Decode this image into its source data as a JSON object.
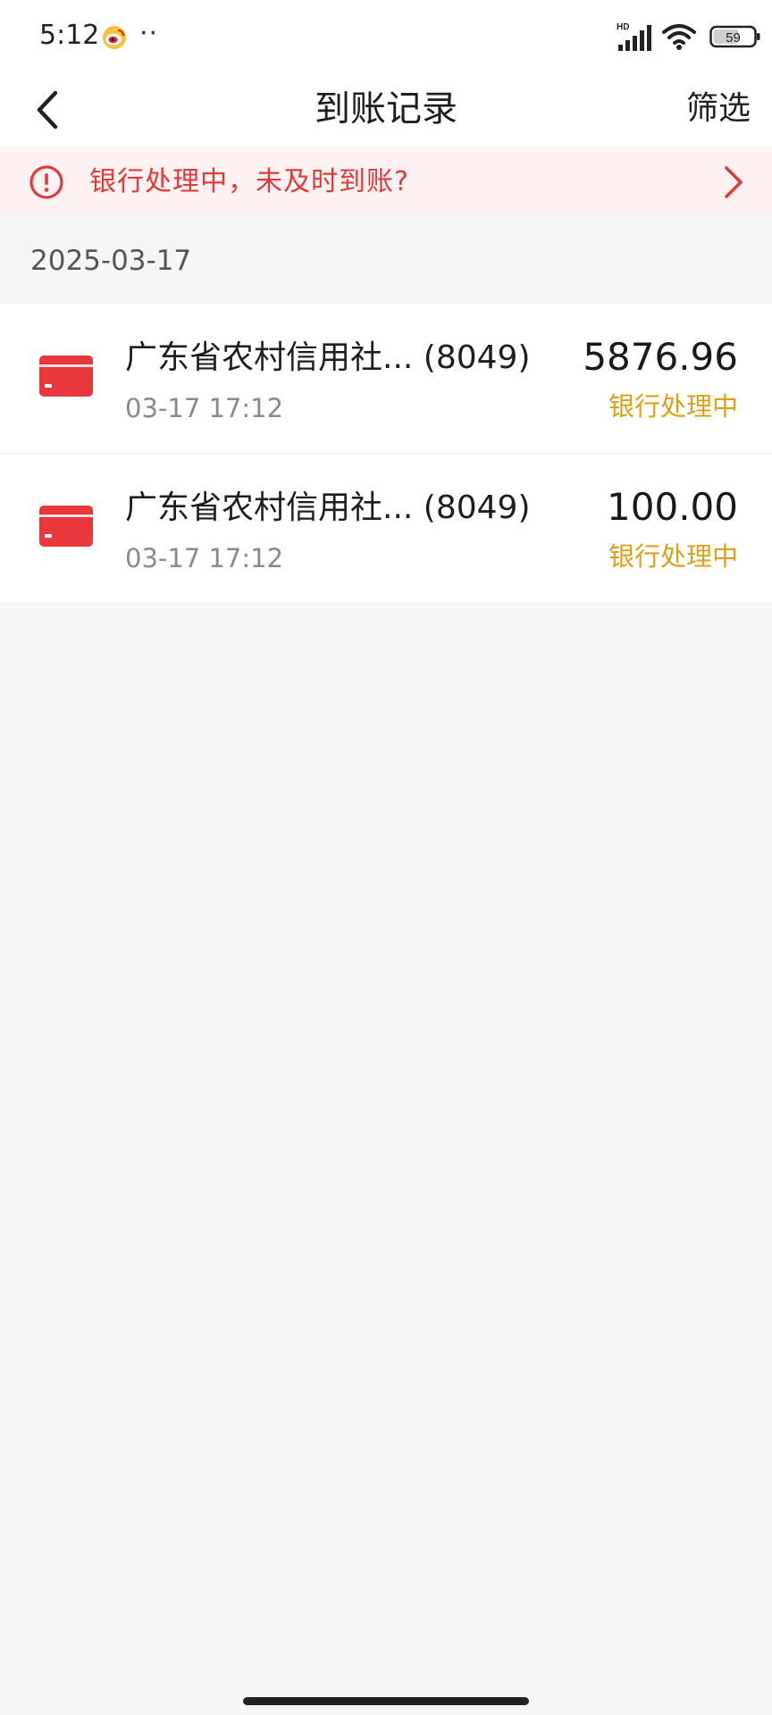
{
  "status_bar": {
    "time": "5:12",
    "notification_icon": "weibo-icon",
    "dots": "··",
    "network_label": "HD",
    "battery": "59"
  },
  "nav": {
    "title": "到账记录",
    "filter_label": "筛选",
    "back_icon": "chevron-left-icon"
  },
  "alert": {
    "text": "银行处理中，未及时到账?",
    "icon": "exclamation-circle-icon",
    "arrow_icon": "chevron-right-icon",
    "color": "#e03a3a",
    "background": "#fdf1f1"
  },
  "date_group": "2025-03-17",
  "records": [
    {
      "bank": "广东省农村信用社...",
      "card_suffix": "(8049)",
      "time": "03-17 17:12",
      "amount": "5876.96",
      "status": "银行处理中"
    },
    {
      "bank": "广东省农村信用社...",
      "card_suffix": "(8049)",
      "time": "03-17 17:12",
      "amount": "100.00",
      "status": "银行处理中"
    }
  ],
  "colors": {
    "status_pending": "#dca11a",
    "card_icon": "#e8383d",
    "page_background": "#f7f7f9"
  }
}
